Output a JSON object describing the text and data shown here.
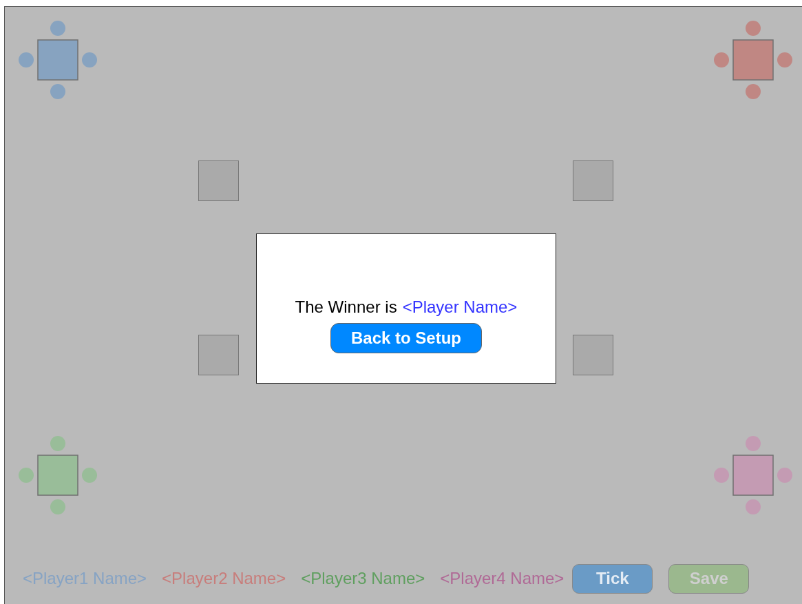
{
  "tables": [
    {
      "color": "#87a3c0"
    },
    {
      "color": "#c08783"
    },
    {
      "color": "#99bd99"
    },
    {
      "color": "#c49bb3"
    }
  ],
  "dialog": {
    "message": "The Winner is",
    "winner": "<Player Name>",
    "button": "Back to Setup"
  },
  "players": [
    {
      "name": "<Player1 Name>",
      "color": "#86a3c4"
    },
    {
      "name": "<Player2 Name>",
      "color": "#c87d7b"
    },
    {
      "name": "<Player3 Name>",
      "color": "#5f9f5f"
    },
    {
      "name": "<Player4 Name>",
      "color": "#b06a96"
    }
  ],
  "buttons": [
    {
      "label": "Tick",
      "kind": "tick",
      "disabled": false
    },
    {
      "label": "Save",
      "kind": "save",
      "disabled": true
    }
  ]
}
